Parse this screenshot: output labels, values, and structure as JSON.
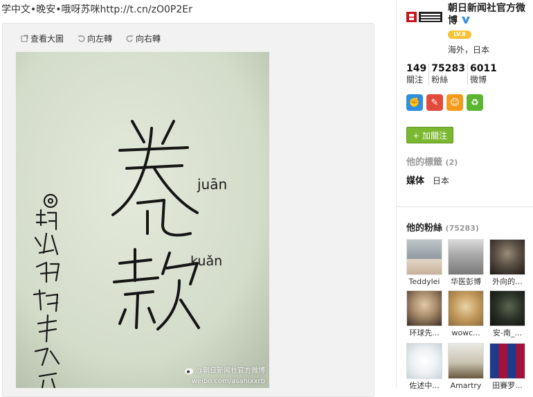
{
  "post": {
    "text": "学中文•晚安•哦呀苏咪http://t.cn/zO0P2Er"
  },
  "toolbar": {
    "view_large": "查看大圖",
    "rotate_left": "向左轉",
    "rotate_right": "向右轉"
  },
  "photo": {
    "annotation_juan": "juān",
    "annotation_kuan": "kuǎn",
    "watermark_account": "@朝日新闻社官方微博",
    "watermark_url": "weibo.com/asahixxrb"
  },
  "profile": {
    "name": "朝日新闻社官方微博",
    "level": "LV.8",
    "location": "海外，日本",
    "stats": [
      {
        "value": "149",
        "label": "關注"
      },
      {
        "value": "75283",
        "label": "粉絲"
      },
      {
        "value": "6011",
        "label": "微博"
      }
    ],
    "follow_label": "加關注",
    "follow_plus": "+",
    "tags_title": "他的標籤",
    "tags_count": "(2)",
    "tags": [
      {
        "name": "媒体",
        "extra": "日本"
      }
    ],
    "fans_title": "他的粉絲",
    "fans_count": "(75283)"
  },
  "fans": [
    {
      "name": "Teddylei",
      "icon": "avatar-young-man"
    },
    {
      "name": "华医彭博",
      "icon": "avatar-man-shirt"
    },
    {
      "name": "外向的...",
      "icon": "avatar-man-dark"
    },
    {
      "name": "环球先...",
      "icon": "avatar-historical-portrait"
    },
    {
      "name": "wowc...",
      "icon": "avatar-lion"
    },
    {
      "name": "安-南_...",
      "icon": "avatar-dark-face"
    },
    {
      "name": "佐述中...",
      "icon": "avatar-white-cat"
    },
    {
      "name": "Amartry",
      "icon": "avatar-figurine"
    },
    {
      "name": "田賽罗...",
      "icon": "avatar-club-crest"
    }
  ],
  "colors": {
    "follow_green": "#7ab82f",
    "verified_blue": "#3b8fe0",
    "level_yellow": "#f6c236"
  }
}
